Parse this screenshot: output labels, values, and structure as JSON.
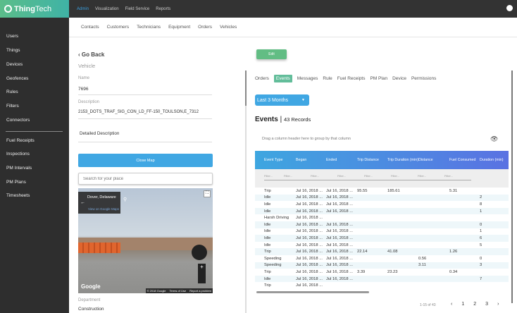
{
  "brand": {
    "name_bold": "Thing",
    "name_light": "Tech"
  },
  "topnav": [
    "Admin",
    "Visualization",
    "Field Service",
    "Reports"
  ],
  "sidebar": {
    "group1": [
      "Users",
      "Things",
      "Devices",
      "Geofences",
      "Rules",
      "Filters",
      "Connectors"
    ],
    "group2": [
      "Fuel Receipts",
      "Inspections",
      "PM Intervals",
      "PM Plans",
      "Timesheets"
    ]
  },
  "subnav": [
    "Contacts",
    "Customers",
    "Technicians",
    "Equipment",
    "Orders",
    "Vehicles"
  ],
  "left": {
    "go_back": "Go Back",
    "section": "Vehicle",
    "name_label": "Name",
    "name_value": "7696",
    "desc_label": "Description",
    "desc_value": "2153_DOTS_TRAF_SIG_CON_LD_FF-150_TOULSON,E_7312",
    "detailed_label": "Detailed Description",
    "close_map": "Close Map",
    "search_placeholder": "Search for your place",
    "map": {
      "place": "Dover, Delaware",
      "view_link": "View on Google Maps",
      "google": "Google",
      "copyright": "© 2018 Google",
      "terms": "Terms of Use",
      "report": "Report a problem"
    },
    "dept_label": "Department",
    "dept_value": "Construction"
  },
  "right": {
    "edit": "Edit",
    "tabs": [
      "Orders",
      "Events",
      "Messages",
      "Rule",
      "Fuel Receipts",
      "PM Plan",
      "Device",
      "Permissions"
    ],
    "active_tab": "Events",
    "range": "Last 3 Months",
    "title": "Events",
    "records": "43 Records",
    "group_hint": "Drag a column header here to group by that column",
    "columns": [
      "Event Type",
      "Began",
      "Ended",
      "Trip Distance",
      "Trip Duration (min)",
      "Distance",
      "Fuel Consumed",
      "Duration (min)"
    ],
    "filter_placeholder": "Filter...",
    "rows": [
      [
        "Trip",
        "Jul 16, 2018 ...",
        "Jul 16, 2018 ...",
        "95.55",
        "185.61",
        "",
        "5.31",
        ""
      ],
      [
        "Idle",
        "Jul 16, 2018 ...",
        "Jul 16, 2018 ...",
        "",
        "",
        "",
        "",
        "2"
      ],
      [
        "Idle",
        "Jul 16, 2018 ...",
        "Jul 16, 2018 ...",
        "",
        "",
        "",
        "",
        "8"
      ],
      [
        "Idle",
        "Jul 16, 2018 ...",
        "Jul 16, 2018 ...",
        "",
        "",
        "",
        "",
        "1"
      ],
      [
        "Harsh Driving",
        "Jul 16, 2018 ...",
        "",
        "",
        "",
        "",
        "",
        ""
      ],
      [
        "Idle",
        "Jul 16, 2018 ...",
        "Jul 16, 2018 ...",
        "",
        "",
        "",
        "",
        "0"
      ],
      [
        "Idle",
        "Jul 16, 2018 ...",
        "Jul 16, 2018 ...",
        "",
        "",
        "",
        "",
        "1"
      ],
      [
        "Idle",
        "Jul 16, 2018 ...",
        "Jul 16, 2018 ...",
        "",
        "",
        "",
        "",
        "6"
      ],
      [
        "Idle",
        "Jul 16, 2018 ...",
        "Jul 16, 2018 ...",
        "",
        "",
        "",
        "",
        "5"
      ],
      [
        "Trip",
        "Jul 16, 2018 ...",
        "Jul 16, 2018 ...",
        "22.14",
        "41.08",
        "",
        "1.26",
        ""
      ],
      [
        "Speeding",
        "Jul 16, 2018 ...",
        "Jul 16, 2018 ...",
        "",
        "",
        "0.56",
        "",
        "0"
      ],
      [
        "Speeding",
        "Jul 16, 2018 ...",
        "Jul 16, 2018 ...",
        "",
        "",
        "3.11",
        "",
        "3"
      ],
      [
        "Trip",
        "Jul 16, 2018 ...",
        "Jul 16, 2018 ...",
        "3.39",
        "23.23",
        "",
        "0.34",
        ""
      ],
      [
        "Idle",
        "Jul 16, 2018 ...",
        "Jul 16, 2018 ...",
        "",
        "",
        "",
        "",
        "7"
      ],
      [
        "Trip",
        "Jul 16, 2018 ...",
        "",
        "",
        "",
        "",
        "",
        ""
      ]
    ],
    "page_info": "1-15 of 43",
    "pages": [
      "1",
      "2",
      "3"
    ]
  },
  "colors": {
    "accent": "#40a7e3",
    "green": "#62bd84",
    "sidebar": "#2e2e2e"
  }
}
